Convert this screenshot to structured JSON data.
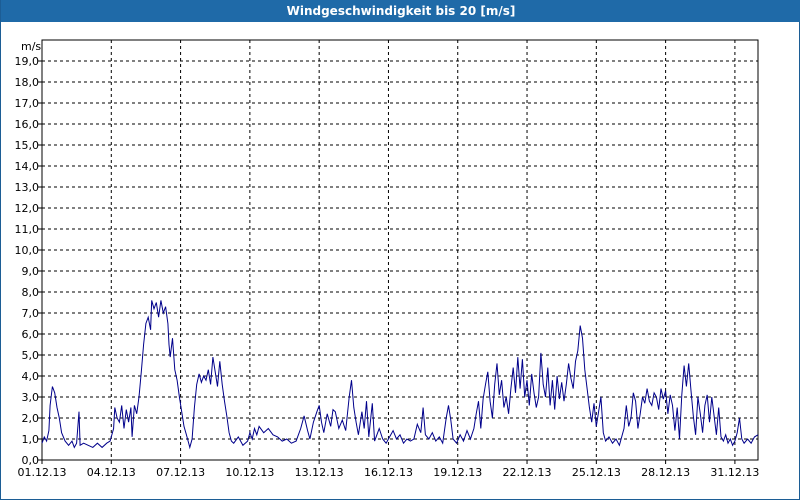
{
  "window": {
    "title": "Windgeschwindigkeit bis 20 [m/s]"
  },
  "chart_data": {
    "type": "line",
    "title": "Windgeschwindigkeit bis 20 [m/s]",
    "ylabel": "m/s",
    "xlabel": "",
    "ylim": [
      0,
      20
    ],
    "xlim": [
      1,
      32
    ],
    "grid": true,
    "line_color": "#00008b",
    "y_ticks": [
      "0,0",
      "1,0",
      "2,0",
      "3,0",
      "4,0",
      "5,0",
      "6,0",
      "7,0",
      "8,0",
      "9,0",
      "10,0",
      "11,0",
      "12,0",
      "13,0",
      "14,0",
      "15,0",
      "16,0",
      "17,0",
      "18,0",
      "19,0"
    ],
    "x_ticks": [
      {
        "day": 1,
        "label": "01.12.13"
      },
      {
        "day": 4,
        "label": "04.12.13"
      },
      {
        "day": 7,
        "label": "07.12.13"
      },
      {
        "day": 10,
        "label": "10.12.13"
      },
      {
        "day": 13,
        "label": "13.12.13"
      },
      {
        "day": 16,
        "label": "16.12.13"
      },
      {
        "day": 19,
        "label": "19.12.13"
      },
      {
        "day": 22,
        "label": "22.12.13"
      },
      {
        "day": 25,
        "label": "25.12.13"
      },
      {
        "day": 28,
        "label": "28.12.13"
      },
      {
        "day": 31,
        "label": "31.12.13"
      }
    ],
    "series": [
      {
        "points": [
          [
            1.0,
            0.8
          ],
          [
            1.1,
            1.1
          ],
          [
            1.2,
            0.9
          ],
          [
            1.3,
            1.4
          ],
          [
            1.35,
            2.6
          ],
          [
            1.45,
            3.5
          ],
          [
            1.55,
            3.2
          ],
          [
            1.65,
            2.5
          ],
          [
            1.75,
            2.0
          ],
          [
            1.85,
            1.3
          ],
          [
            2.0,
            0.9
          ],
          [
            2.15,
            0.7
          ],
          [
            2.3,
            0.9
          ],
          [
            2.4,
            0.6
          ],
          [
            2.5,
            0.8
          ],
          [
            2.6,
            2.3
          ],
          [
            2.65,
            0.7
          ],
          [
            2.8,
            0.8
          ],
          [
            3.0,
            0.7
          ],
          [
            3.2,
            0.6
          ],
          [
            3.4,
            0.8
          ],
          [
            3.6,
            0.6
          ],
          [
            3.8,
            0.8
          ],
          [
            3.95,
            0.9
          ],
          [
            4.1,
            1.5
          ],
          [
            4.15,
            2.5
          ],
          [
            4.25,
            2.0
          ],
          [
            4.35,
            1.8
          ],
          [
            4.45,
            2.6
          ],
          [
            4.55,
            1.5
          ],
          [
            4.65,
            2.4
          ],
          [
            4.75,
            1.8
          ],
          [
            4.85,
            2.5
          ],
          [
            4.9,
            1.1
          ],
          [
            5.0,
            2.6
          ],
          [
            5.1,
            2.2
          ],
          [
            5.2,
            3.0
          ],
          [
            5.3,
            4.2
          ],
          [
            5.4,
            5.5
          ],
          [
            5.5,
            6.5
          ],
          [
            5.6,
            6.8
          ],
          [
            5.7,
            6.2
          ],
          [
            5.75,
            7.6
          ],
          [
            5.85,
            7.2
          ],
          [
            5.95,
            7.5
          ],
          [
            6.05,
            6.8
          ],
          [
            6.15,
            7.6
          ],
          [
            6.25,
            7.0
          ],
          [
            6.35,
            7.3
          ],
          [
            6.45,
            6.5
          ],
          [
            6.5,
            5.5
          ],
          [
            6.55,
            4.9
          ],
          [
            6.65,
            5.8
          ],
          [
            6.75,
            4.3
          ],
          [
            6.85,
            3.8
          ],
          [
            6.95,
            3.0
          ],
          [
            7.05,
            2.3
          ],
          [
            7.15,
            1.6
          ],
          [
            7.25,
            1.2
          ],
          [
            7.35,
            0.8
          ],
          [
            7.4,
            0.6
          ],
          [
            7.5,
            1.0
          ],
          [
            7.6,
            2.5
          ],
          [
            7.7,
            3.6
          ],
          [
            7.8,
            4.1
          ],
          [
            7.9,
            3.7
          ],
          [
            8.0,
            4.0
          ],
          [
            8.1,
            3.8
          ],
          [
            8.2,
            4.3
          ],
          [
            8.3,
            3.6
          ],
          [
            8.4,
            4.9
          ],
          [
            8.5,
            4.2
          ],
          [
            8.6,
            3.5
          ],
          [
            8.7,
            4.7
          ],
          [
            8.8,
            3.6
          ],
          [
            8.9,
            2.8
          ],
          [
            9.0,
            2.1
          ],
          [
            9.1,
            1.3
          ],
          [
            9.2,
            0.9
          ],
          [
            9.3,
            0.8
          ],
          [
            9.5,
            1.1
          ],
          [
            9.7,
            0.7
          ],
          [
            9.9,
            0.9
          ],
          [
            10.0,
            1.3
          ],
          [
            10.1,
            1.0
          ],
          [
            10.2,
            1.5
          ],
          [
            10.3,
            1.2
          ],
          [
            10.4,
            1.6
          ],
          [
            10.6,
            1.3
          ],
          [
            10.8,
            1.5
          ],
          [
            11.0,
            1.2
          ],
          [
            11.2,
            1.1
          ],
          [
            11.4,
            0.9
          ],
          [
            11.6,
            1.0
          ],
          [
            11.8,
            0.8
          ],
          [
            12.0,
            0.9
          ],
          [
            12.2,
            1.5
          ],
          [
            12.35,
            2.1
          ],
          [
            12.5,
            1.4
          ],
          [
            12.6,
            1.0
          ],
          [
            12.75,
            1.8
          ],
          [
            12.9,
            2.3
          ],
          [
            13.0,
            2.6
          ],
          [
            13.1,
            1.8
          ],
          [
            13.2,
            1.3
          ],
          [
            13.35,
            2.2
          ],
          [
            13.5,
            1.6
          ],
          [
            13.6,
            2.4
          ],
          [
            13.7,
            2.3
          ],
          [
            13.85,
            1.5
          ],
          [
            14.0,
            1.9
          ],
          [
            14.15,
            1.4
          ],
          [
            14.3,
            3.0
          ],
          [
            14.4,
            3.8
          ],
          [
            14.5,
            2.5
          ],
          [
            14.6,
            1.8
          ],
          [
            14.7,
            1.2
          ],
          [
            14.85,
            2.3
          ],
          [
            14.95,
            1.5
          ],
          [
            15.05,
            2.8
          ],
          [
            15.15,
            1.1
          ],
          [
            15.3,
            2.7
          ],
          [
            15.4,
            0.9
          ],
          [
            15.5,
            1.2
          ],
          [
            15.6,
            1.5
          ],
          [
            15.75,
            1.0
          ],
          [
            15.9,
            0.8
          ],
          [
            16.05,
            1.1
          ],
          [
            16.2,
            1.4
          ],
          [
            16.35,
            1.0
          ],
          [
            16.5,
            1.2
          ],
          [
            16.65,
            0.8
          ],
          [
            16.8,
            1.0
          ],
          [
            16.95,
            0.9
          ],
          [
            17.1,
            1.0
          ],
          [
            17.25,
            1.7
          ],
          [
            17.4,
            1.3
          ],
          [
            17.5,
            2.5
          ],
          [
            17.6,
            1.2
          ],
          [
            17.75,
            1.0
          ],
          [
            17.9,
            1.3
          ],
          [
            18.05,
            0.9
          ],
          [
            18.2,
            1.1
          ],
          [
            18.35,
            0.8
          ],
          [
            18.5,
            2.0
          ],
          [
            18.6,
            2.6
          ],
          [
            18.7,
            1.9
          ],
          [
            18.8,
            1.0
          ],
          [
            18.95,
            0.8
          ],
          [
            19.1,
            1.2
          ],
          [
            19.25,
            0.9
          ],
          [
            19.4,
            1.4
          ],
          [
            19.55,
            1.0
          ],
          [
            19.7,
            1.5
          ],
          [
            19.8,
            2.2
          ],
          [
            19.9,
            2.8
          ],
          [
            20.0,
            1.5
          ],
          [
            20.1,
            2.9
          ],
          [
            20.2,
            3.6
          ],
          [
            20.3,
            4.2
          ],
          [
            20.4,
            2.8
          ],
          [
            20.5,
            2.0
          ],
          [
            20.6,
            3.6
          ],
          [
            20.7,
            4.6
          ],
          [
            20.8,
            3.1
          ],
          [
            20.9,
            3.8
          ],
          [
            21.0,
            2.5
          ],
          [
            21.1,
            3.0
          ],
          [
            21.2,
            2.2
          ],
          [
            21.3,
            3.4
          ],
          [
            21.4,
            4.4
          ],
          [
            21.5,
            3.2
          ],
          [
            21.6,
            4.9
          ],
          [
            21.7,
            3.4
          ],
          [
            21.8,
            4.8
          ],
          [
            21.9,
            3.0
          ],
          [
            22.0,
            3.8
          ],
          [
            22.1,
            2.6
          ],
          [
            22.2,
            4.1
          ],
          [
            22.3,
            3.2
          ],
          [
            22.4,
            2.5
          ],
          [
            22.5,
            3.0
          ],
          [
            22.6,
            5.1
          ],
          [
            22.7,
            3.6
          ],
          [
            22.8,
            3.0
          ],
          [
            22.9,
            4.4
          ],
          [
            23.0,
            2.6
          ],
          [
            23.1,
            3.8
          ],
          [
            23.2,
            2.4
          ],
          [
            23.3,
            4.0
          ],
          [
            23.4,
            2.9
          ],
          [
            23.5,
            3.7
          ],
          [
            23.6,
            2.8
          ],
          [
            23.7,
            3.6
          ],
          [
            23.8,
            4.6
          ],
          [
            23.9,
            3.9
          ],
          [
            24.0,
            3.4
          ],
          [
            24.1,
            4.7
          ],
          [
            24.2,
            5.2
          ],
          [
            24.3,
            6.4
          ],
          [
            24.4,
            5.8
          ],
          [
            24.5,
            4.3
          ],
          [
            24.6,
            3.4
          ],
          [
            24.7,
            2.5
          ],
          [
            24.8,
            1.8
          ],
          [
            24.9,
            2.7
          ],
          [
            25.0,
            1.6
          ],
          [
            25.1,
            2.3
          ],
          [
            25.2,
            3.0
          ],
          [
            25.3,
            1.3
          ],
          [
            25.4,
            0.9
          ],
          [
            25.55,
            1.1
          ],
          [
            25.7,
            0.8
          ],
          [
            25.85,
            1.0
          ],
          [
            26.0,
            0.7
          ],
          [
            26.1,
            1.1
          ],
          [
            26.2,
            1.5
          ],
          [
            26.3,
            2.6
          ],
          [
            26.4,
            1.6
          ],
          [
            26.5,
            2.0
          ],
          [
            26.6,
            3.2
          ],
          [
            26.7,
            2.8
          ],
          [
            26.8,
            1.5
          ],
          [
            26.9,
            2.2
          ],
          [
            27.0,
            3.0
          ],
          [
            27.1,
            2.7
          ],
          [
            27.2,
            3.4
          ],
          [
            27.3,
            2.8
          ],
          [
            27.4,
            2.6
          ],
          [
            27.5,
            3.2
          ],
          [
            27.6,
            3.0
          ],
          [
            27.7,
            2.4
          ],
          [
            27.8,
            3.4
          ],
          [
            27.9,
            2.9
          ],
          [
            28.0,
            3.3
          ],
          [
            28.1,
            2.2
          ],
          [
            28.2,
            3.1
          ],
          [
            28.3,
            2.6
          ],
          [
            28.4,
            1.4
          ],
          [
            28.5,
            2.5
          ],
          [
            28.6,
            1.0
          ],
          [
            28.7,
            3.1
          ],
          [
            28.8,
            4.5
          ],
          [
            28.9,
            3.5
          ],
          [
            29.0,
            4.6
          ],
          [
            29.1,
            3.3
          ],
          [
            29.2,
            2.1
          ],
          [
            29.3,
            1.2
          ],
          [
            29.4,
            3.0
          ],
          [
            29.5,
            2.2
          ],
          [
            29.6,
            1.3
          ],
          [
            29.7,
            2.6
          ],
          [
            29.8,
            3.1
          ],
          [
            29.9,
            1.8
          ],
          [
            30.0,
            3.0
          ],
          [
            30.1,
            2.1
          ],
          [
            30.2,
            1.2
          ],
          [
            30.3,
            2.5
          ],
          [
            30.4,
            1.1
          ],
          [
            30.5,
            0.9
          ],
          [
            30.6,
            1.2
          ],
          [
            30.7,
            0.8
          ],
          [
            30.8,
            1.0
          ],
          [
            30.9,
            0.7
          ],
          [
            31.0,
            0.9
          ],
          [
            31.1,
            1.3
          ],
          [
            31.2,
            2.0
          ],
          [
            31.3,
            1.0
          ],
          [
            31.4,
            0.8
          ],
          [
            31.55,
            1.0
          ],
          [
            31.7,
            0.8
          ],
          [
            31.85,
            1.1
          ],
          [
            32.0,
            1.2
          ]
        ]
      }
    ]
  }
}
